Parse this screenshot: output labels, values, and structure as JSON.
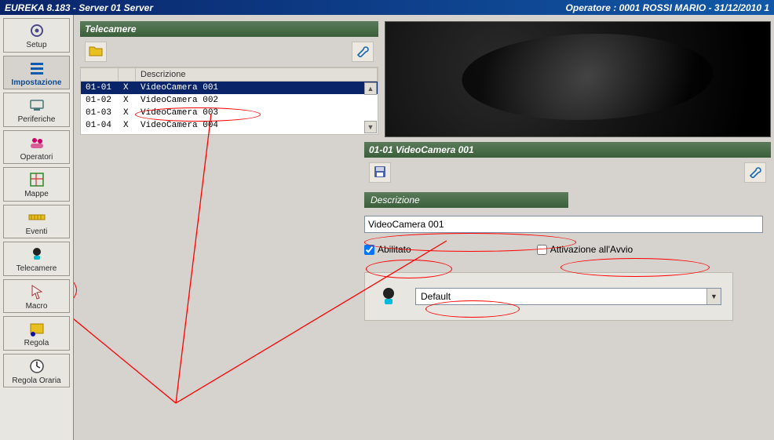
{
  "titlebar": {
    "left": "EUREKA 8.183  -  Server 01 Server",
    "right": "Operatore : 0001 ROSSI MARIO - 31/12/2010 1"
  },
  "nav": {
    "setup": "Setup",
    "impostazione": "Impostazione",
    "periferiche": "Periferiche",
    "operatori": "Operatori",
    "mappe": "Mappe",
    "eventi": "Eventi",
    "telecamere": "Telecamere",
    "macro": "Macro",
    "regola": "Regola",
    "regola_oraria": "Regola Oraria"
  },
  "list_panel": {
    "title": "Telecamere",
    "header": {
      "col1": "",
      "col2": "",
      "col3": "Descrizione"
    },
    "rows": [
      {
        "code": "01-01",
        "flag": "X",
        "desc": "VideoCamera 001",
        "selected": true
      },
      {
        "code": "01-02",
        "flag": "X",
        "desc": "VideoCamera 002",
        "selected": false
      },
      {
        "code": "01-03",
        "flag": "X",
        "desc": "VideoCamera 003",
        "selected": false
      },
      {
        "code": "01-04",
        "flag": "X",
        "desc": "VideoCamera 004",
        "selected": false
      }
    ]
  },
  "detail": {
    "title": "01-01 VideoCamera 001",
    "section_label": "Descrizione",
    "desc_value": "VideoCamera 001",
    "abilitato_label": "Abilitato",
    "abilitato_checked": true,
    "attivazione_label": "Attivazione all'Avvio",
    "attivazione_checked": false,
    "combo_value": "Default"
  }
}
